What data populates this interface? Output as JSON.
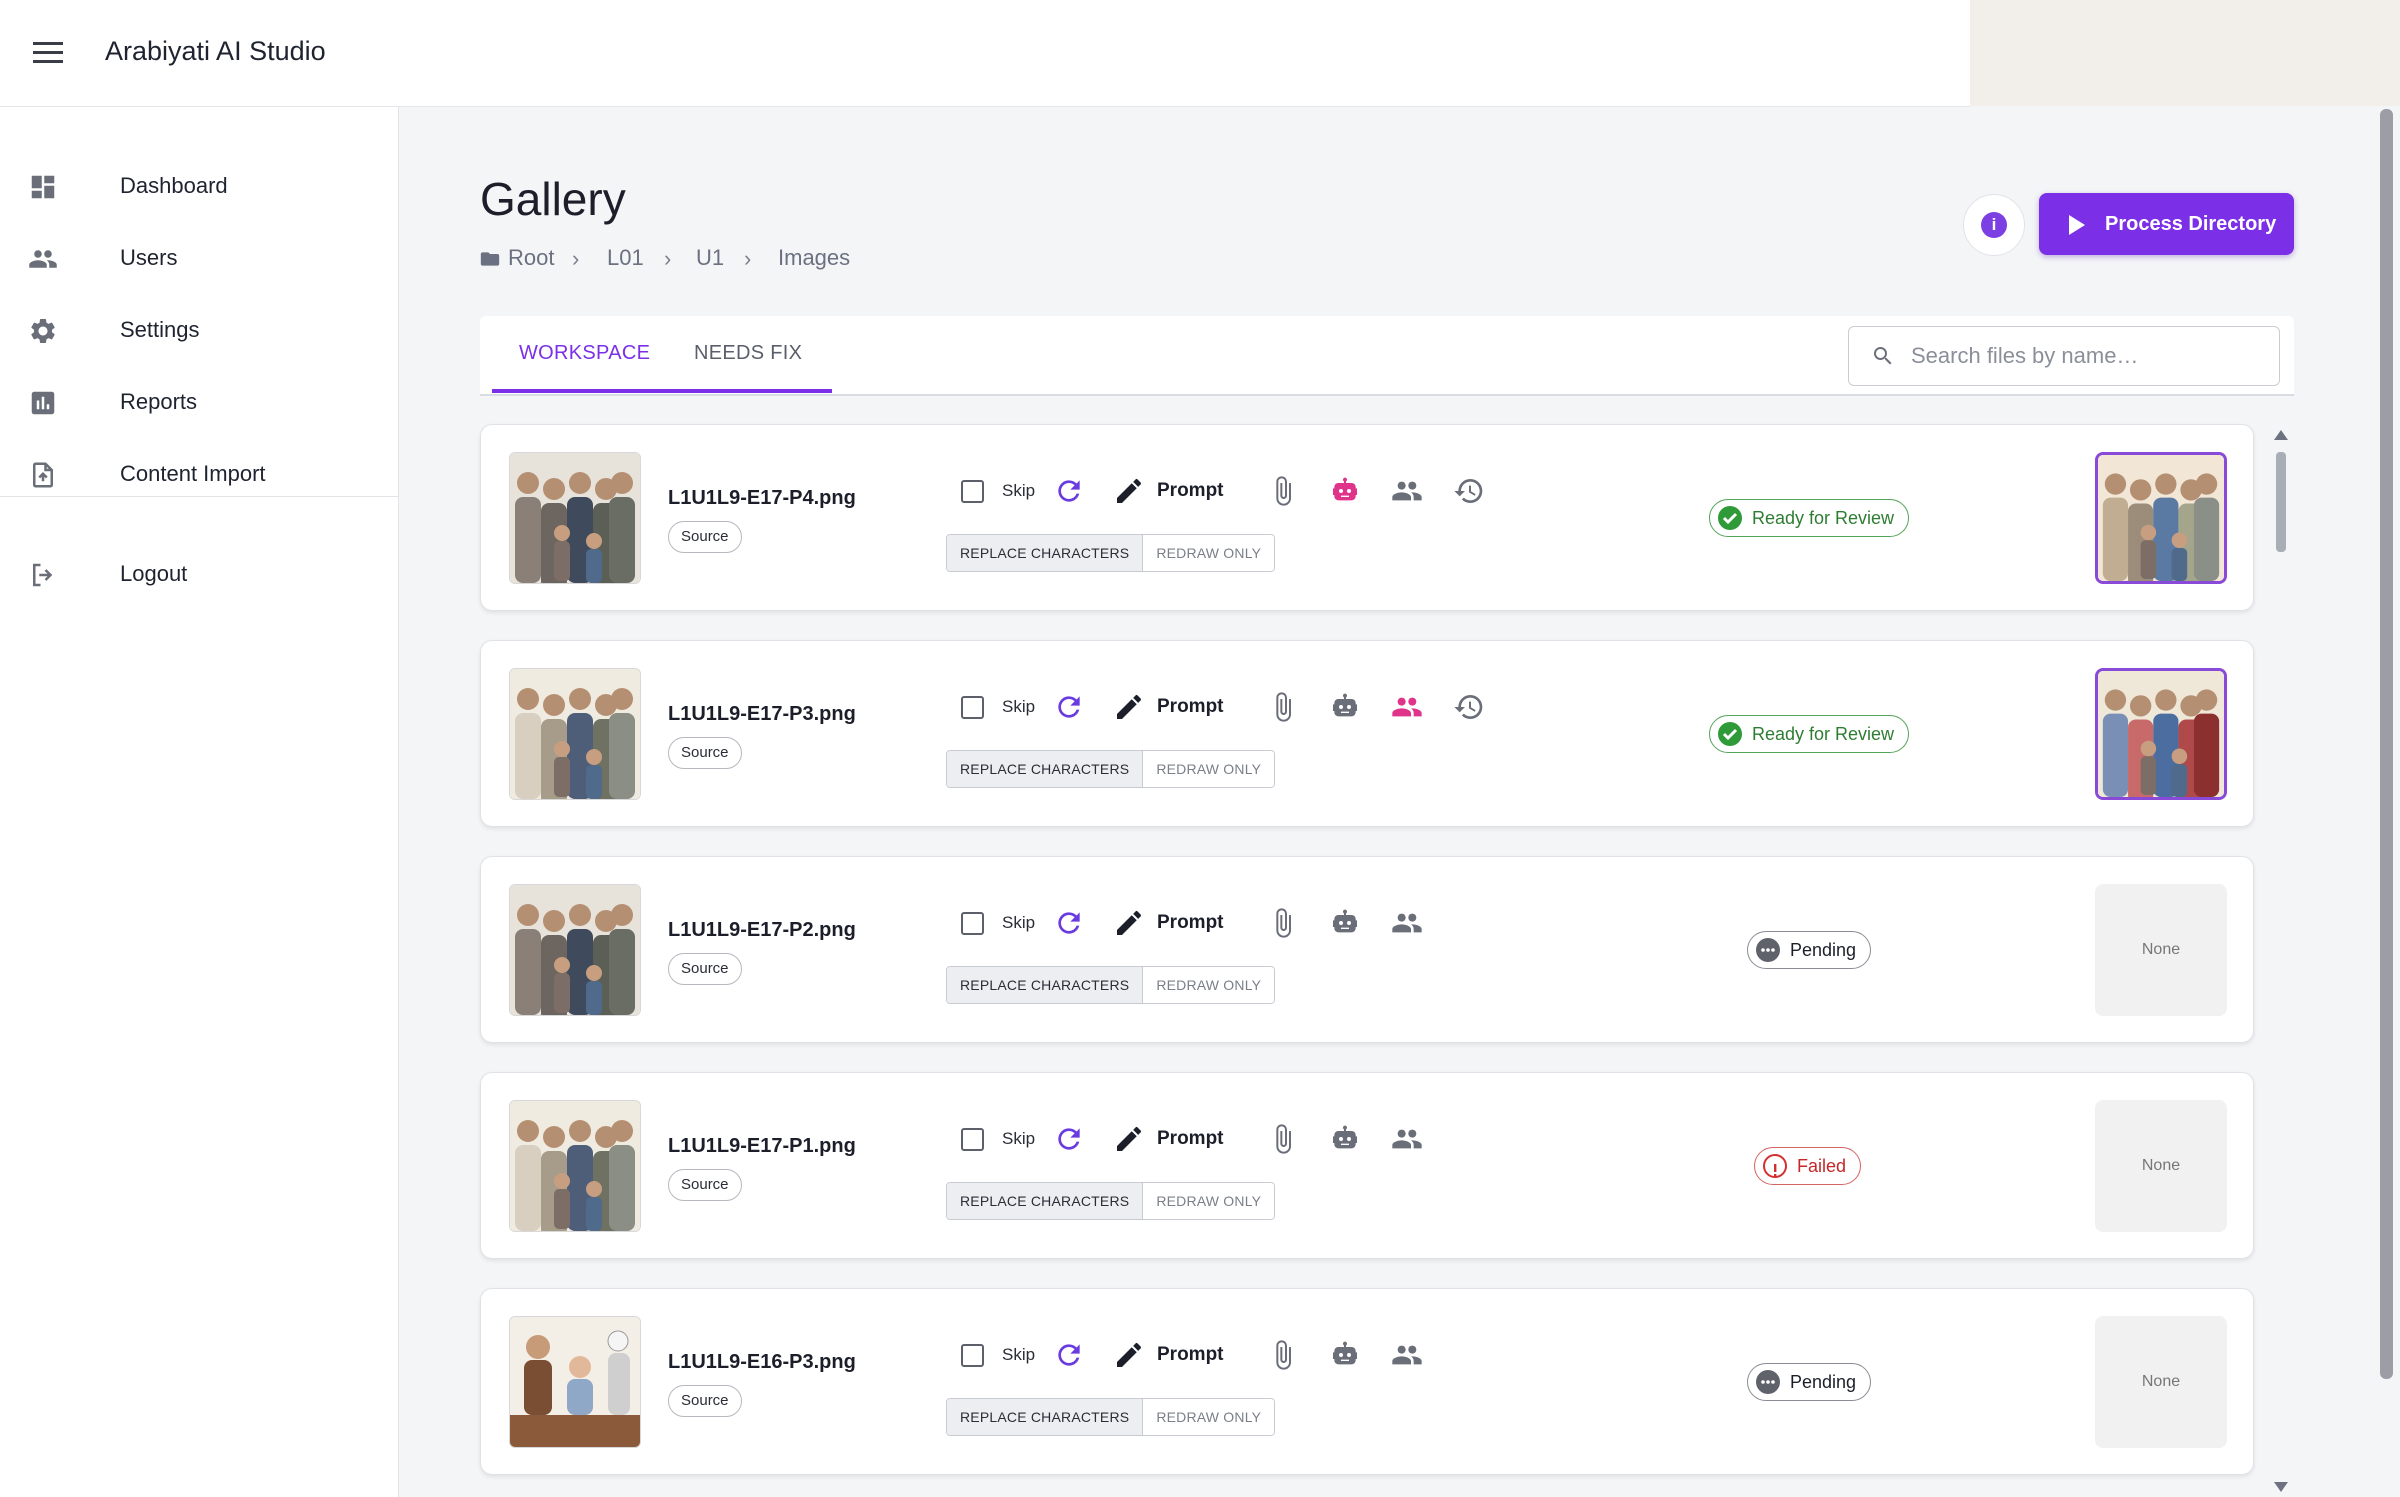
{
  "app": {
    "title": "Arabiyati AI Studio"
  },
  "sidebar": {
    "items": [
      {
        "label": "Dashboard",
        "icon": "dashboard-icon"
      },
      {
        "label": "Users",
        "icon": "users-icon"
      },
      {
        "label": "Settings",
        "icon": "gear-icon"
      },
      {
        "label": "Reports",
        "icon": "reports-icon"
      },
      {
        "label": "Content Import",
        "icon": "file-upload-icon"
      },
      {
        "label": "Logout",
        "icon": "logout-icon"
      }
    ]
  },
  "header": {
    "title": "Gallery",
    "breadcrumb": [
      "Root",
      "L01",
      "U1",
      "Images"
    ],
    "process_label": "Process Directory"
  },
  "tabs": [
    "WORKSPACE",
    "NEEDS FIX"
  ],
  "search": {
    "placeholder": "Search files by name…",
    "value": ""
  },
  "row_labels": {
    "source": "Source",
    "skip": "Skip",
    "prompt": "Prompt",
    "replace": "REPLACE CHARACTERS",
    "redraw": "REDRAW ONLY",
    "none": "None"
  },
  "rows": [
    {
      "filename": "L1U1L9-E17-P4.png",
      "status": "Ready for Review",
      "status_kind": "ready",
      "result": "image",
      "robot_active": true,
      "people_active": false,
      "history": true
    },
    {
      "filename": "L1U1L9-E17-P3.png",
      "status": "Ready for Review",
      "status_kind": "ready",
      "result": "image",
      "robot_active": false,
      "people_active": true,
      "history": true
    },
    {
      "filename": "L1U1L9-E17-P2.png",
      "status": "Pending",
      "status_kind": "pending",
      "result": "none",
      "robot_active": false,
      "people_active": false,
      "history": false
    },
    {
      "filename": "L1U1L9-E17-P1.png",
      "status": "Failed",
      "status_kind": "failed",
      "result": "none",
      "robot_active": false,
      "people_active": false,
      "history": false
    },
    {
      "filename": "L1U1L9-E16-P3.png",
      "status": "Pending",
      "status_kind": "pending",
      "result": "none",
      "robot_active": false,
      "people_active": false,
      "history": false
    }
  ],
  "colors": {
    "accent": "#7b2fe6",
    "ready": "#2e7d32",
    "failed": "#c62828",
    "active_icon": "#e0348a"
  }
}
